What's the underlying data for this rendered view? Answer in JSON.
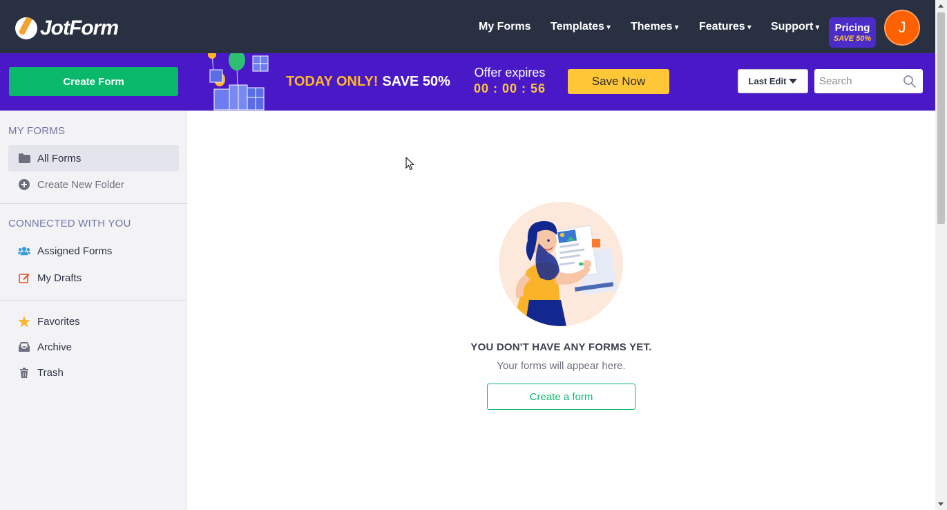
{
  "brand": {
    "name": "JotForm"
  },
  "nav": {
    "items": [
      {
        "label": "My Forms",
        "has_caret": false
      },
      {
        "label": "Templates",
        "has_caret": true
      },
      {
        "label": "Themes",
        "has_caret": true
      },
      {
        "label": "Features",
        "has_caret": true
      },
      {
        "label": "Support",
        "has_caret": true
      }
    ],
    "caret": "▾",
    "pricing": {
      "label": "Pricing",
      "badge": "SAVE 50%"
    },
    "avatar_initial": "J"
  },
  "promo": {
    "create_button": "Create Form",
    "today_only": "TODAY ONLY!",
    "save_text": "SAVE 50%",
    "offer_label": "Offer expires",
    "timer": "00 : 00 : 56",
    "save_now": "Save Now"
  },
  "toolbar": {
    "sort_label": "Last Edit",
    "search_placeholder": "Search"
  },
  "sidebar": {
    "my_forms_heading": "MY FORMS",
    "all_forms": "All Forms",
    "create_folder": "Create New Folder",
    "connected_heading": "CONNECTED WITH YOU",
    "assigned_forms": "Assigned Forms",
    "my_drafts": "My Drafts",
    "favorites": "Favorites",
    "archive": "Archive",
    "trash": "Trash"
  },
  "empty_state": {
    "title": "YOU DON'T HAVE ANY FORMS YET.",
    "subtitle": "Your forms will appear here.",
    "button": "Create a form"
  },
  "colors": {
    "nav_bg": "#283042",
    "promo_bg": "#4a19c7",
    "primary_green": "#0ab86c",
    "accent_yellow": "#ffc738",
    "avatar_orange": "#ff6100"
  }
}
